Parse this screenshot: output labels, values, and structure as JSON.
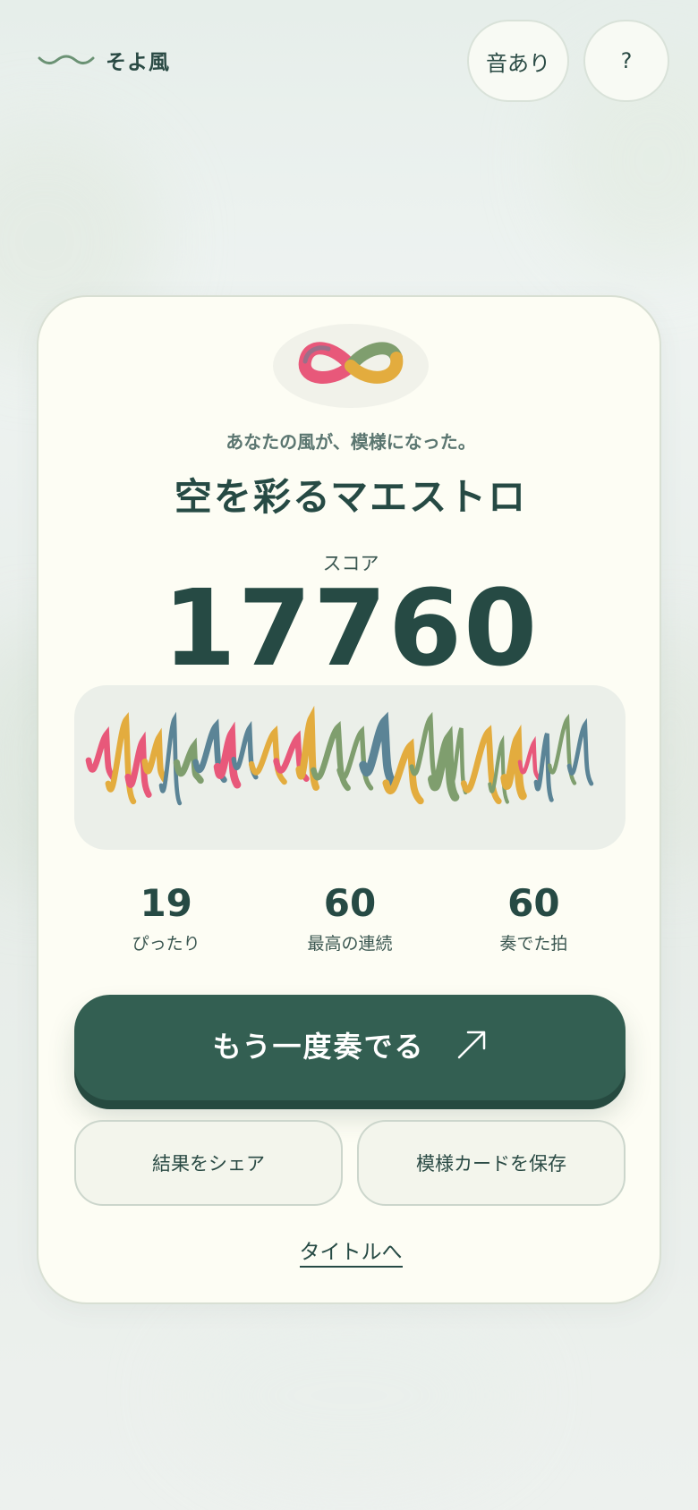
{
  "app": {
    "name": "そよ風"
  },
  "header": {
    "sound_label": "音あり",
    "help_label": "?"
  },
  "result": {
    "tagline": "あなたの風が、模様になった。",
    "title": "空を彩るマエストロ",
    "score_label": "スコア",
    "score_value": "17760"
  },
  "stats": [
    {
      "value": "19",
      "label": "ぴったり"
    },
    {
      "value": "60",
      "label": "最高の連続"
    },
    {
      "value": "60",
      "label": "奏でた拍"
    }
  ],
  "actions": {
    "replay_label": "もう一度奏でる",
    "share_label": "結果をシェア",
    "save_label": "模様カードを保存",
    "title_link": "タイトルへ"
  },
  "colors": {
    "accent": "#335f52",
    "ribbon_red": "#e8587a",
    "ribbon_green": "#7f9e6e",
    "ribbon_yellow": "#e3ac3e",
    "ribbon_blue": "#5b8496"
  },
  "icons": {
    "brand": "wind-wave-icon",
    "emblem": "infinity-ribbon-icon",
    "replay": "arrow-up-right-icon"
  }
}
